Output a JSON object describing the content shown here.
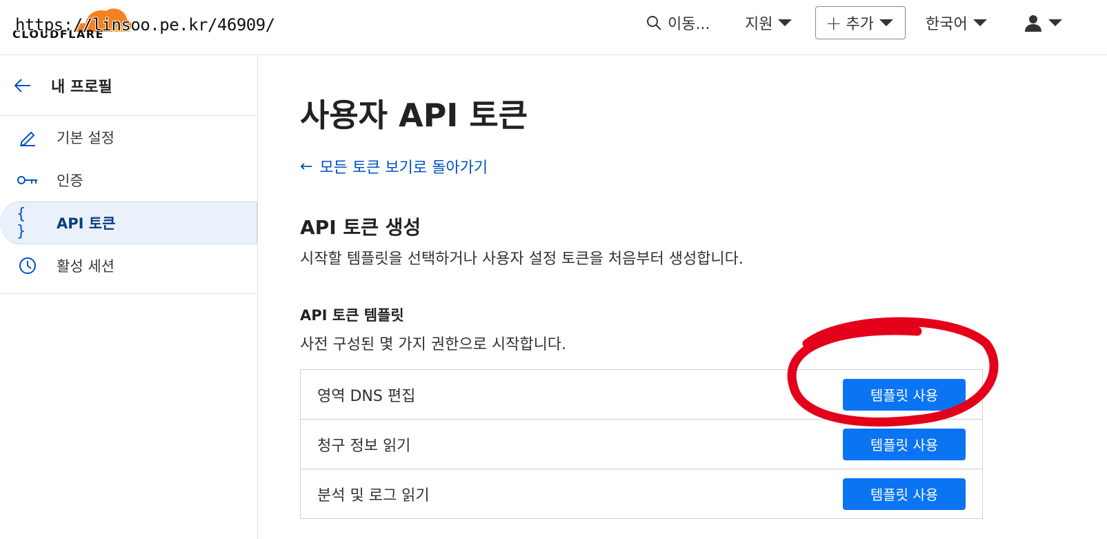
{
  "header": {
    "logo_text": "CLOUDFLARE",
    "watermark": "https://linsoo.pe.kr/46909/",
    "search_label": "이동...",
    "support_label": "지원",
    "add_label": "추가",
    "add_plus": "+",
    "language_label": "한국어"
  },
  "sidebar": {
    "back_icon": "arrow-left-icon",
    "title": "내 프로필",
    "items": [
      {
        "label": "기본 설정",
        "icon": "pencil-icon",
        "active": false
      },
      {
        "label": "인증",
        "icon": "key-icon",
        "active": false
      },
      {
        "label": "API 토큰",
        "icon": "braces-icon",
        "icon_glyph": "{ }",
        "active": true
      },
      {
        "label": "활성 세션",
        "icon": "clock-icon",
        "active": false
      }
    ]
  },
  "main": {
    "page_title": "사용자 API 토큰",
    "back_link_arrow": "←",
    "back_link": "모든 토큰 보기로 돌아가기",
    "create_title": "API 토큰 생성",
    "create_desc": "시작할 템플릿을 선택하거나 사용자 설정 토큰을 처음부터 생성합니다.",
    "templates_title": "API 토큰 템플릿",
    "templates_desc": "사전 구성된 몇 가지 권한으로 시작합니다.",
    "templates": [
      {
        "name": "영역 DNS 편집",
        "button": "템플릿 사용"
      },
      {
        "name": "청구 정보 읽기",
        "button": "템플릿 사용"
      },
      {
        "name": "분석 및 로그 읽기",
        "button": "템플릿 사용"
      }
    ]
  },
  "colors": {
    "accent": "#0051c3",
    "button": "#0b74f2",
    "brand_orange": "#f6821f",
    "annotation": "#e4001b"
  }
}
